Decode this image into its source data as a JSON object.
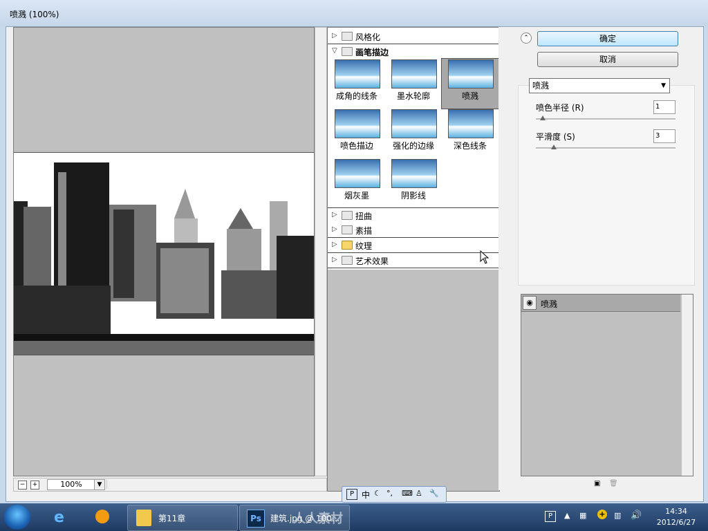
{
  "window": {
    "title": "喷溅 (100%)"
  },
  "preview": {
    "zoom": "100%",
    "zoom_out": "−",
    "zoom_in": "+"
  },
  "gallery": {
    "categories_top": [
      {
        "label": "风格化",
        "expanded": false
      },
      {
        "label": "画笔描边",
        "expanded": true
      }
    ],
    "filters": [
      "成角的线条",
      "墨水轮廓",
      "喷溅",
      "喷色描边",
      "强化的边缘",
      "深色线条",
      "烟灰墨",
      "阴影线"
    ],
    "selected_filter": "喷溅",
    "categories_bottom": [
      "扭曲",
      "素描",
      "纹理",
      "艺术效果"
    ]
  },
  "buttons": {
    "ok": "确定",
    "cancel": "取消"
  },
  "settings": {
    "filter_select": "喷溅",
    "sliders": [
      {
        "label": "喷色半径",
        "key": "(R)",
        "value": "1",
        "level": 0.05
      },
      {
        "label": "平滑度",
        "key": "(S)",
        "value": "3",
        "level": 0.13
      }
    ]
  },
  "layers": {
    "items": [
      {
        "name": "喷溅"
      }
    ]
  },
  "ime": {
    "items": [
      "中"
    ]
  },
  "taskbar": {
    "apps": [
      {
        "label": "第11章"
      },
      {
        "label": "建筑.jpg @ 100..."
      }
    ],
    "watermark": "人人素材",
    "clock_time": "14:34",
    "clock_date": "2012/6/27"
  },
  "colors": {
    "accent": "#3c7fb1",
    "selected_tile": "#a8a8a8",
    "taskbar": "#1d3a63"
  }
}
